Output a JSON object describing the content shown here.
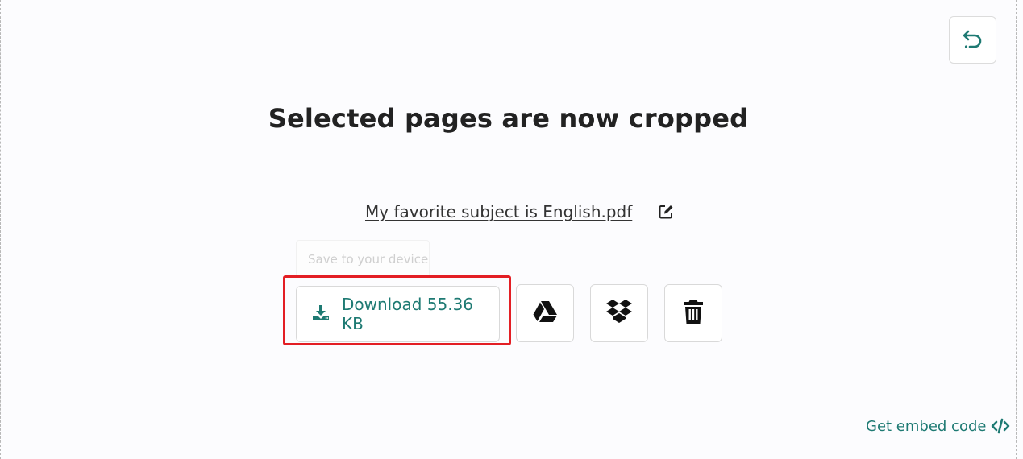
{
  "page": {
    "title": "Selected pages are now cropped",
    "filename": "My favorite subject is English.pdf",
    "tooltip": "Save to your device",
    "download_label": "Download 55.36 KB",
    "embed_label": "Get embed code"
  },
  "icons": {
    "undo": "undo-icon",
    "edit": "edit-icon",
    "download": "download-icon",
    "google_drive": "google-drive-icon",
    "dropbox": "dropbox-icon",
    "delete": "trash-icon",
    "embed": "code-icon"
  },
  "colors": {
    "accent": "#1e7a73",
    "highlight": "#e31e24",
    "title": "#222222"
  }
}
